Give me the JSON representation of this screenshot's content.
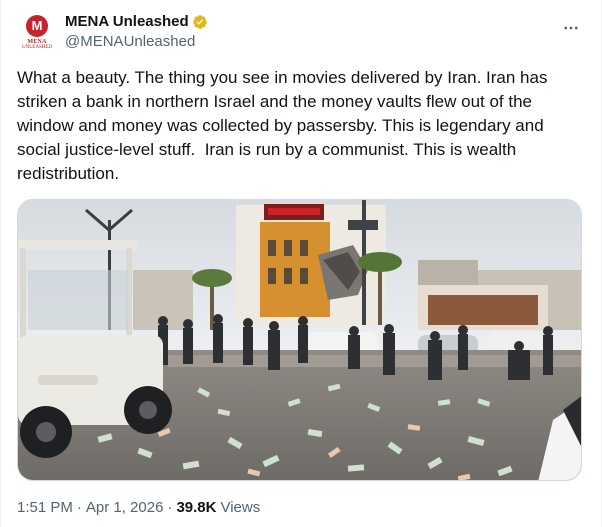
{
  "author": {
    "display_name": "MENA Unleashed",
    "handle": "@MENAUnleashed",
    "avatar_text": "MENA",
    "avatar_subtext": "UNLEASHED",
    "verified_color": "#e2b719"
  },
  "more_icon": "more-horizontal-icon",
  "post": {
    "text": "What a beauty. The thing you see in movies delivered by Iran. Iran has striken a bank in northern Israel and the money vaults flew out of the window and money was collected by passersby. This is legendary and social justice-level stuff.  Iran is run by a communist. This is wealth redistribution."
  },
  "media": {
    "alt": "Street scene with banknotes scattered on the ground in front of a damaged building while people collect the money, a golf cart in the foreground."
  },
  "meta": {
    "time": "1:51 PM",
    "separator": "·",
    "date": "Apr 1, 2026",
    "views_count": "39.8K",
    "views_label": "Views"
  },
  "colors": {
    "text_primary": "#0f1419",
    "text_secondary": "#536471",
    "border": "#cfd9de"
  }
}
